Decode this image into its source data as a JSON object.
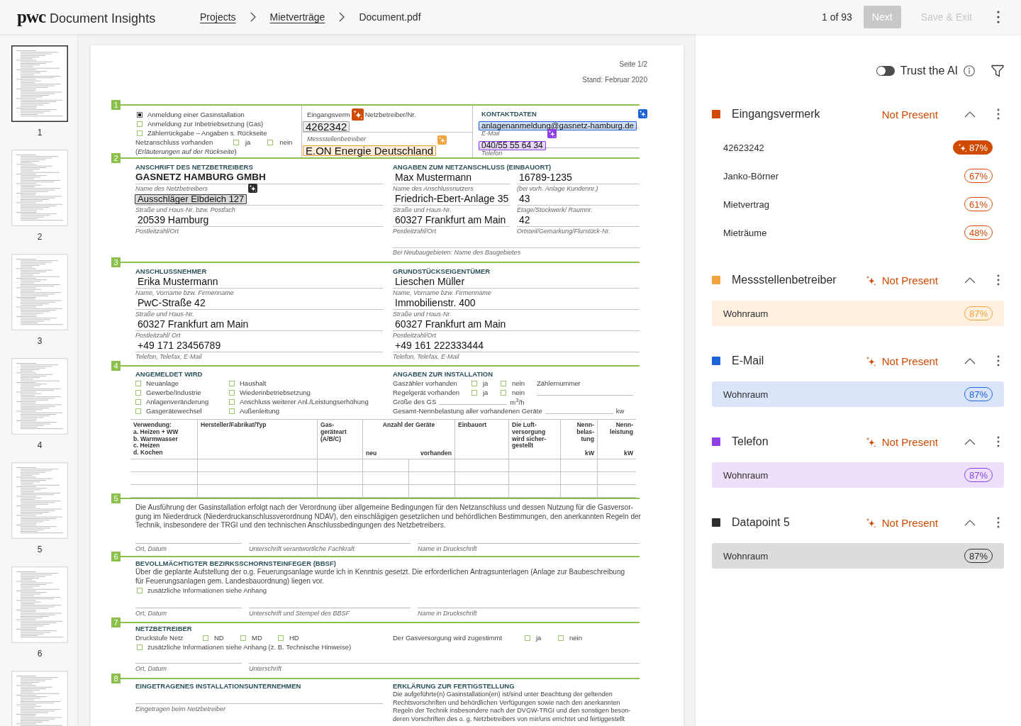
{
  "header": {
    "logo": "pwc",
    "app_title": "Document Insights",
    "breadcrumbs": [
      {
        "label": "Projects",
        "link": true
      },
      {
        "label": "Mietverträge",
        "link": true
      },
      {
        "label": "Document.pdf",
        "link": false
      }
    ],
    "page_counter": "1 of 93",
    "buttons": [
      {
        "label": "Next",
        "kind": "filled",
        "disabled": true
      },
      {
        "label": "Save & Exit",
        "kind": "plain",
        "disabled": true
      }
    ]
  },
  "thumbnails": [
    {
      "label": "1",
      "selected": true
    },
    {
      "label": "2",
      "selected": false
    },
    {
      "label": "3",
      "selected": false
    },
    {
      "label": "4",
      "selected": false
    },
    {
      "label": "5",
      "selected": false
    },
    {
      "label": "6",
      "selected": false
    },
    {
      "selected": false
    }
  ],
  "document": {
    "page_info": [
      "Seite 1/2",
      "Stand: Februar 2020"
    ],
    "sections": [
      {
        "number": "1",
        "kind": "registration",
        "requests": [
          {
            "label": "Anmeldung einer Gasinstallation",
            "checked": true
          },
          {
            "label": "Anmeldung zur Inbetriebsetzung (Gas)",
            "checked": false
          },
          {
            "label": "Zählerrückgabe – Angaben s. Rückseite",
            "checked": false
          }
        ],
        "connection": {
          "label": "Netzanschluss vorhanden",
          "options": [
            {
              "label": "ja",
              "checked": false
            },
            {
              "label": "nein",
              "checked": false
            }
          ]
        },
        "note": "(*Erläuterungen auf der Rückseite*)",
        "receipt": {
          "label_parts": [
            "Eingangsverm",
            "Netzbetreiber/Nr."
          ],
          "value": "4262342",
          "color": "#a5a5a5",
          "marker": {
            "color": "#d04a02"
          }
        },
        "metering": {
          "label": "Messstellenbetreiber",
          "value": "E.ON Energie Deutschland",
          "color": "#f0a23c",
          "marker": {
            "color": "#f0a23c"
          }
        },
        "contact": {
          "heading": "KONTAKTDATEN",
          "fields": [
            {
              "value": "anlagenanmeldung@gasnetz-hamburg.de",
              "label": "E-Mail",
              "color": "#1d63d8",
              "marker": {
                "color": "#1d63d8"
              }
            },
            {
              "value": "040/55 55 64 34",
              "label": "Telefon",
              "color": "#8f40e4",
              "marker": {
                "color": "#8f40e4"
              }
            }
          ]
        }
      },
      {
        "number": "2",
        "kind": "parties",
        "columns": [
          {
            "heading": "ANSCHRIFT DES NETZBETREIBERS",
            "rows": [
              [
                {
                  "value": "GASNETZ HAMBURG GMBH",
                  "label": "Name des Netzbetreibers",
                  "bold": true
                }
              ],
              [
                {
                  "value": "Ausschläger Elbdeich 127",
                  "label": "Straße und Haus-Nr. bzw. Postfach",
                  "color": "#3a3a3a",
                  "marker": {
                    "color": "#2d2d2d"
                  }
                }
              ],
              [
                {
                  "value": "20539 Hamburg",
                  "label": "Postleitzahl/Ort"
                }
              ]
            ]
          },
          {
            "heading": "ANGABEN ZUM NETZANSCHLUSS (EINBAUORT)",
            "rows": [
              [
                {
                  "value": "Max Mustermann",
                  "label": "Name des Anschlussnutzers"
                },
                {
                  "value": "16789-1235",
                  "label": "(bei vorh. Anlage Kundennr.)"
                }
              ],
              [
                {
                  "value": "Friedrich-Ebert-Anlage 35",
                  "label": "Straße und Haus-Nr."
                },
                {
                  "value": "43",
                  "label": "Etage/Stockwerk/ Raumnr."
                }
              ],
              [
                {
                  "value": "60327 Frankfurt am Main",
                  "label": "Postleitzahl/Ort"
                },
                {
                  "value": "42",
                  "label": "Ortsteil/Gemarkung/Flurstück-Nr."
                }
              ],
              [
                {
                  "label": "Bei Neubaugebieten: Name des Baugebietes"
                }
              ]
            ]
          }
        ]
      },
      {
        "number": "3",
        "kind": "parties",
        "columns": [
          {
            "heading": "ANSCHLUSSNEHMER",
            "rows": [
              [
                {
                  "value": "Erika Mustermann",
                  "label": "Name, Vorname bzw. Firmenname"
                }
              ],
              [
                {
                  "value": "PwC-Straße 42",
                  "label": "Straße und Haus-Nr."
                }
              ],
              [
                {
                  "value": "60327 Frankfurt am Main",
                  "label": "Postleitzahl/ Ort"
                }
              ],
              [
                {
                  "value": "+49 171 23456789",
                  "label": "Telefon, Telefax, E-Mail"
                }
              ]
            ]
          },
          {
            "heading": "GRUNDSTÜCKSEIGENTÜMER",
            "rows": [
              [
                {
                  "value": "Lieschen Müller",
                  "label": "Name, Vorname bzw. Firmenname"
                }
              ],
              [
                {
                  "value": "Immobilienstr. 400",
                  "label": "Straße und Haus-Nr."
                }
              ],
              [
                {
                  "value": "60327 Frankfurt am Main",
                  "label": "Postleitzahl/Ort"
                }
              ],
              [
                {
                  "value": "+49 161 222333444",
                  "label": "Telefon, Telefax, E-Mail"
                }
              ]
            ]
          }
        ]
      },
      {
        "number": "4",
        "kind": "installation",
        "registered": {
          "heading": "ANGEMELDET WIRD",
          "columns": [
            [
              {
                "label": "Neuanlage",
                "checked": false
              },
              {
                "label": "Gewerbe/Industrie",
                "checked": false
              },
              {
                "label": "Anlagenveränderung",
                "checked": false
              },
              {
                "label": "Gasgerätewechsel",
                "checked": false
              }
            ],
            [
              {
                "label": "Haushalt",
                "checked": false
              },
              {
                "label": "Wiederinbetriebsetzung",
                "checked": false
              },
              {
                "label": "Anschluss weiterer Anl./Leistungserhöhung",
                "checked": false
              },
              {
                "label": "Außenleitung",
                "checked": false
              }
            ]
          ]
        },
        "details": {
          "heading": "ANGABEN ZUR INSTALLATION",
          "rows": [
            {
              "kind": "yes_no",
              "label": "Gaszähler vorhanden",
              "options": [
                {
                  "label": "ja",
                  "checked": false
                },
                {
                  "label": "nein",
                  "checked": false
                }
              ],
              "note": "Zählernummer"
            },
            {
              "kind": "yes_no",
              "label": "Regelgerät vorhanden",
              "options": [
                {
                  "label": "ja",
                  "checked": false
                },
                {
                  "label": "nein",
                  "checked": false
                }
              ],
              "blank": true
            },
            {
              "kind": "measure",
              "label": "Größe des GS",
              "unit": "m$^{3}$/h"
            },
            {
              "kind": "measure",
              "label": "Gesamt-Nennbelastung aller vorhandenen Geräte",
              "unit": "kw"
            }
          ]
        },
        "table": {
          "columns": [
            {
              "label": "Verwendung:\na. Heizen + WW\nb. Warmwasser\nc. Heizen\nd. Kochen"
            },
            {
              "label": "Hersteller/Fabrikat/Typ"
            },
            {
              "label": "Gas-\ngeräteart\n(A/B/C)"
            },
            {
              "label": "Anzahl der Geräte",
              "subcolumns": [
                "neu",
                "vorhanden"
              ]
            },
            {
              "label": "Einbauort"
            },
            {
              "label": "Die Luft-\nversorgung\nwird sicher-\ngestellt"
            },
            {
              "label": "Nenn-\nbelas-\ntung",
              "unit": "kW"
            },
            {
              "label": "Nenn-\nleistung",
              "unit": "kW"
            }
          ]
        }
      },
      {
        "number": "5",
        "kind": "statement",
        "lines": [
          "Die Ausführung der Gasinstallation erfolgt nach der Verordnung über allgemeine Bedingungen für den Netzanschluss und dessen Nutzung für die Gasversor-",
          "gung im Niederdruck (Niederdruckanschlussverordnung NDAV), den einschlägigen gesetzlichen und behördlichen Bestimmungen, den anerkannten Regeln der",
          "Technik, insbesondere der TRGI und den technischen Anschlussbedingungen des Netzbetreibers."
        ],
        "signatures": [
          "Ort, Datum",
          "Unterschrift verantwortliche Fachkraft",
          "Name in Druckschrift"
        ]
      },
      {
        "number": "6",
        "kind": "consent",
        "heading": "BEVOLLMÄCHTIGTER BEZIRKSSCHORNSTEINFEGER (BBSF)",
        "lines": [
          "Über die geplante Aufstellung der o.g. Feuerungsanlage wurde ich in Kenntnis gesetzt. Die erforderlichen Antragsunterlagen (Anlage zur Baubeschreibung",
          "für Feuerungsanlagen gem. Landesbauordnung) liegen vor."
        ],
        "options": [
          {
            "label": "zusätzliche Informationen siehe Anhang",
            "checked": false
          }
        ],
        "signatures": [
          "Ort, Datum",
          "Unterschrift und Stempel des BBSF",
          "Name in Druckschrift"
        ]
      },
      {
        "number": "7",
        "kind": "operator",
        "heading": "NETZBETREIBER",
        "pressure": {
          "label": "Druckstufe Netz",
          "options": [
            {
              "label": "ND",
              "checked": false
            },
            {
              "label": "MD",
              "checked": false
            },
            {
              "label": "HD",
              "checked": false
            }
          ]
        },
        "approval": {
          "label": "Der Gasversorgung wird zugestimmt",
          "options": [
            {
              "label": "ja",
              "checked": false
            },
            {
              "label": "nein",
              "checked": false
            }
          ]
        },
        "options": [
          {
            "label": "zusätzliche Informationen siehe Anhang (z. B. Technische Hinweise)",
            "checked": false
          }
        ],
        "signatures": [
          "Ort, Datum",
          "Unterschrift"
        ]
      },
      {
        "number": "8",
        "kind": "completion",
        "company": {
          "heading": "EINGETRAGENES INSTALLATIONSUNTERNEHMEN",
          "label": "Eingetragen beim Netzbetreiber"
        },
        "declaration": {
          "heading": "ERKLÄRUNG ZUR FERTIGSTELLUNG",
          "lines": [
            "Die aufgeführte(n) Gasinstallation(en) ist/sind unter Beachtung der geltenden",
            "Rechtsvorschriften und behördlichen Verfügungen sowie nach den anerkannten",
            "Regeln der Technik insbesondere nach der DVGW-TRGI und den sonstigen beson-",
            "deren Vorschriften des o. g. Netzbetreibers von mir/uns errichtet und fertiggestellt"
          ]
        }
      }
    ]
  },
  "panel": {
    "trust_ai": {
      "label": "Trust the AI",
      "on": false
    },
    "datapoints": [
      {
        "name": "Eingangsvermerk",
        "color": "#d04a02",
        "ai_hint": false,
        "status": "Not Present",
        "expanded": true,
        "candidates": [
          {
            "value": "42623242",
            "confidence": "87%",
            "suggested": true,
            "selected": false
          },
          {
            "value": "Janko-Börner",
            "confidence": "67%",
            "suggested": false,
            "selected": false
          },
          {
            "value": "Mietvertrag",
            "confidence": "61%",
            "suggested": false,
            "selected": false
          },
          {
            "value": "Mieträume",
            "confidence": "48%",
            "suggested": false,
            "selected": false
          }
        ]
      },
      {
        "name": "Messstellenbetreiber",
        "color": "#f0a23c",
        "ai_hint": true,
        "status": "Not Present",
        "expanded": true,
        "candidates": [
          {
            "value": "Wohnraum",
            "confidence": "87%",
            "suggested": false,
            "selected": true
          }
        ]
      },
      {
        "name": "E-Mail",
        "color": "#1d63d8",
        "ai_hint": true,
        "status": "Not Present",
        "expanded": true,
        "candidates": [
          {
            "value": "Wohnraum",
            "confidence": "87%",
            "suggested": false,
            "selected": true
          }
        ]
      },
      {
        "name": "Telefon",
        "color": "#8f40e4",
        "ai_hint": true,
        "status": "Not Present",
        "expanded": true,
        "candidates": [
          {
            "value": "Wohnraum",
            "confidence": "87%",
            "suggested": false,
            "selected": true
          }
        ]
      },
      {
        "name": "Datapoint 5",
        "color": "#2d2d2d",
        "ai_hint": true,
        "status": "Not Present",
        "expanded": true,
        "candidates": [
          {
            "value": "Wohnraum",
            "confidence": "87%",
            "suggested": false,
            "selected": true
          }
        ]
      }
    ]
  }
}
